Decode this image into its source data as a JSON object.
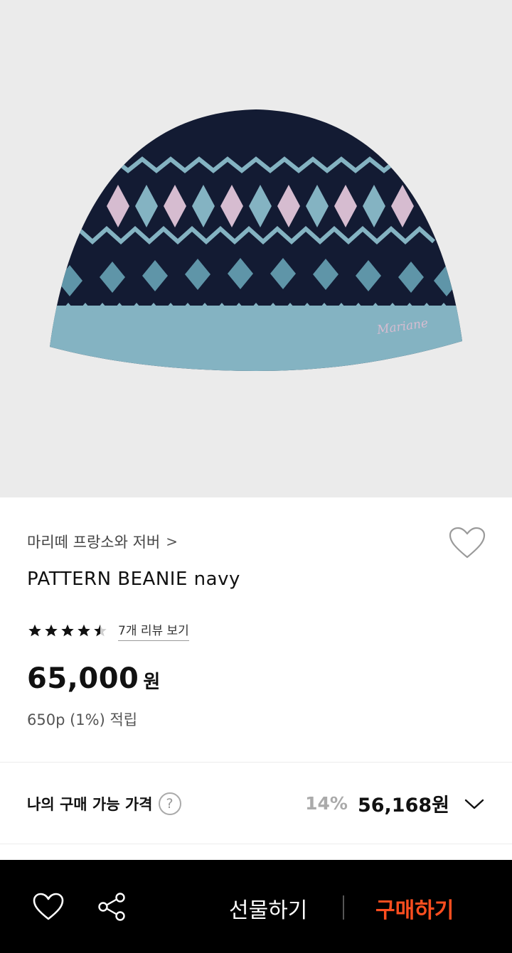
{
  "product": {
    "image_alt": "navy fair-isle knit beanie",
    "brand": "마리떼 프랑소와 저버",
    "brand_chevron": ">",
    "title": "PATTERN BEANIE navy",
    "rating": 4.5,
    "review_link": "7개 리뷰 보기",
    "price_value": "65,000",
    "price_unit": "원",
    "points": "650p (1%) 적립"
  },
  "my_price": {
    "label": "나의 구매 가능 가격",
    "help_glyph": "?",
    "discount": "14%",
    "price": "56,168원"
  },
  "bottom_bar": {
    "gift_label": "선물하기",
    "buy_label": "구매하기"
  },
  "colors": {
    "background": "#ffffff",
    "hero_background": "#ebebeb",
    "beanie_navy": "#131b33",
    "beanie_light_blue": "#84b3c2",
    "beanie_pink": "#d6bcd0",
    "bottom_bar": "#000000",
    "buy_accent": "#ff4e1f",
    "discount_gray": "#aaaaaa"
  },
  "icons": [
    "heart-outline-icon",
    "chevron-right-icon",
    "star-icon",
    "help-circle-icon",
    "chevron-down-icon",
    "share-icon"
  ]
}
